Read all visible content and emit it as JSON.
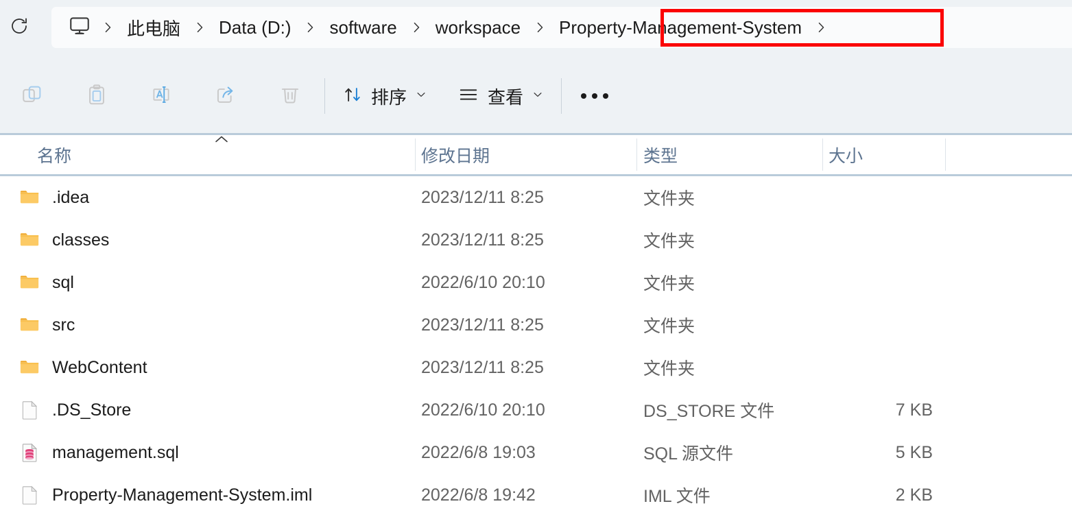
{
  "window": {
    "app": "File Explorer",
    "accent_color": "#0f6cbd",
    "annotation_color": "#fb0203"
  },
  "addressbar": {
    "refresh_icon": "refresh-icon",
    "pc_icon": "monitor-icon",
    "separator_glyph": "›",
    "crumbs": [
      {
        "label": "此电脑",
        "highlighted": false
      },
      {
        "label": "Data (D:)",
        "highlighted": false
      },
      {
        "label": "software",
        "highlighted": false
      },
      {
        "label": "workspace",
        "highlighted": false
      },
      {
        "label": "Property-Management-System",
        "highlighted": true
      }
    ]
  },
  "toolbar": {
    "buttons": [
      {
        "name": "copy-button",
        "icon": "copy-icon",
        "enabled": false
      },
      {
        "name": "paste-button",
        "icon": "paste-icon",
        "enabled": false
      },
      {
        "name": "rename-button",
        "icon": "rename-icon",
        "enabled": false
      },
      {
        "name": "share-button",
        "icon": "share-icon",
        "enabled": false
      },
      {
        "name": "delete-button",
        "icon": "trash-icon",
        "enabled": false
      }
    ],
    "sort_label": "排序",
    "view_label": "查看",
    "more_label": "•••",
    "chevron_glyph": "⌄"
  },
  "columns": {
    "name": "名称",
    "date_modified": "修改日期",
    "type": "类型",
    "size": "大小",
    "sorted_by": "名称",
    "sort_direction": "ascending"
  },
  "files": [
    {
      "name": ".idea",
      "date": "2023/12/11 8:25",
      "type": "文件夹",
      "size": "",
      "icon": "folder-icon"
    },
    {
      "name": "classes",
      "date": "2023/12/11 8:25",
      "type": "文件夹",
      "size": "",
      "icon": "folder-icon"
    },
    {
      "name": "sql",
      "date": "2022/6/10 20:10",
      "type": "文件夹",
      "size": "",
      "icon": "folder-icon"
    },
    {
      "name": "src",
      "date": "2023/12/11 8:25",
      "type": "文件夹",
      "size": "",
      "icon": "folder-icon"
    },
    {
      "name": "WebContent",
      "date": "2023/12/11 8:25",
      "type": "文件夹",
      "size": "",
      "icon": "folder-icon"
    },
    {
      "name": ".DS_Store",
      "date": "2022/6/10 20:10",
      "type": "DS_STORE 文件",
      "size": "7 KB",
      "icon": "file-icon"
    },
    {
      "name": "management.sql",
      "date": "2022/6/8 19:03",
      "type": "SQL 源文件",
      "size": "5 KB",
      "icon": "sql-file-icon"
    },
    {
      "name": "Property-Management-System.iml",
      "date": "2022/6/8 19:42",
      "type": "IML 文件",
      "size": "2 KB",
      "icon": "file-icon"
    }
  ]
}
